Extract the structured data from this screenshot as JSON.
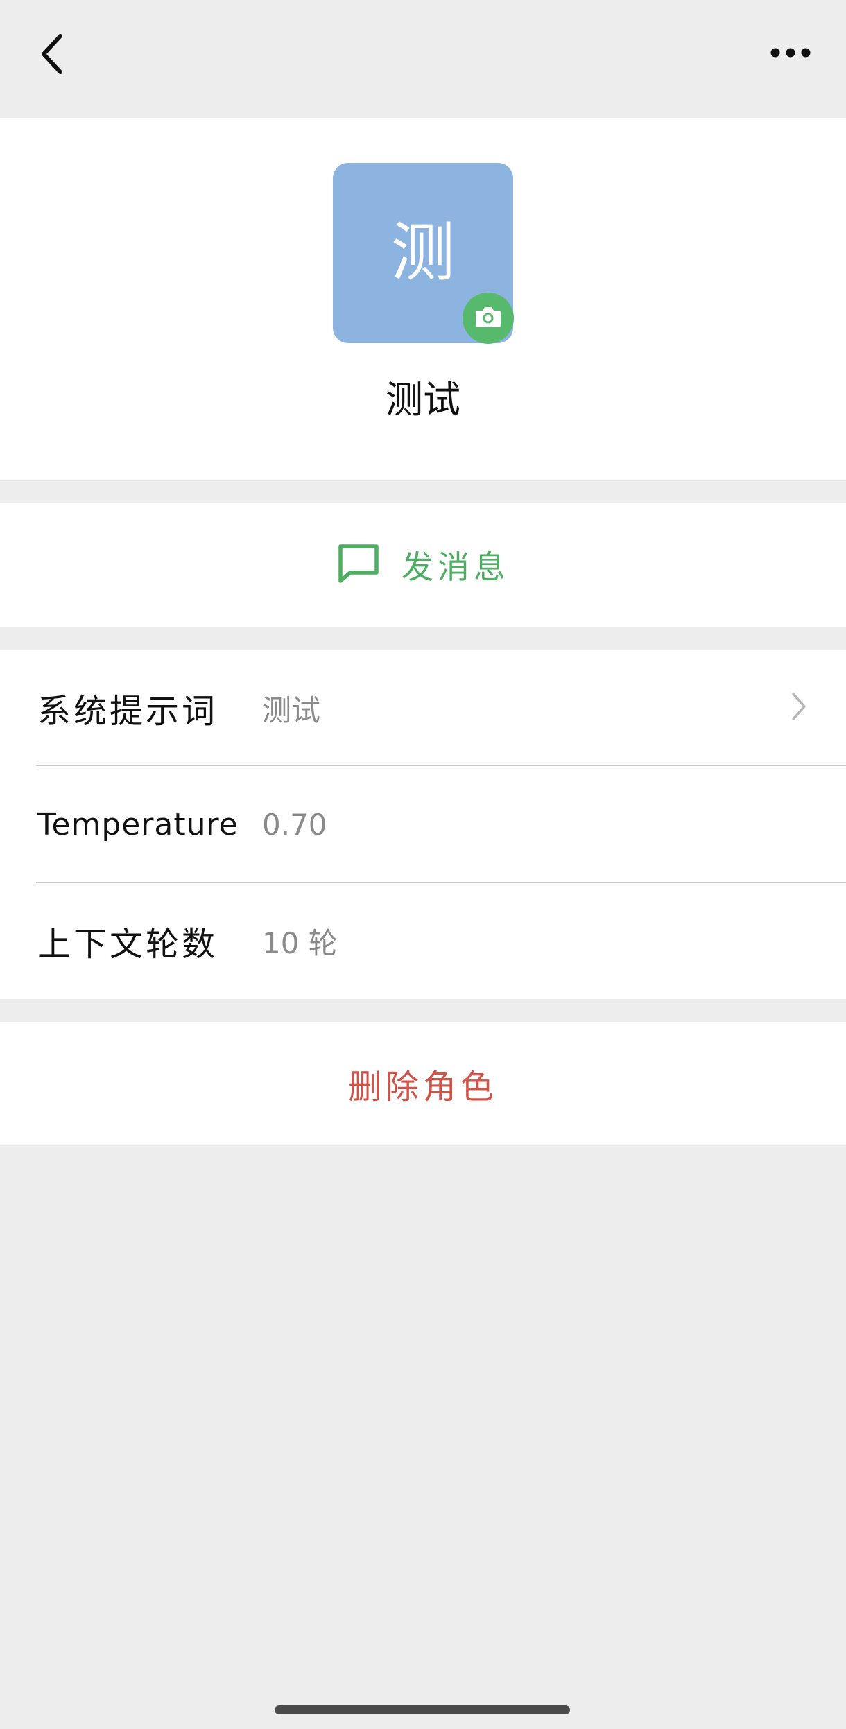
{
  "header": {
    "back_icon": "chevron-left-icon",
    "more_icon": "ellipsis-icon"
  },
  "profile": {
    "avatar_letter": "测",
    "avatar_color": "#8db4e0",
    "camera_icon": "camera-icon",
    "camera_badge_color": "#56b96b",
    "name": "测试"
  },
  "actions": {
    "send_message_icon": "message-square-icon",
    "send_message_label": "发消息",
    "send_color": "#4fae63",
    "delete_label": "删除角色",
    "delete_color": "#d0534a"
  },
  "settings": {
    "rows": [
      {
        "label": "系统提示词",
        "value": "测试",
        "has_chevron": true
      },
      {
        "label": "Temperature",
        "value": "0.70",
        "has_chevron": false
      },
      {
        "label": "上下文轮数",
        "value": "10 轮",
        "has_chevron": false
      }
    ]
  }
}
